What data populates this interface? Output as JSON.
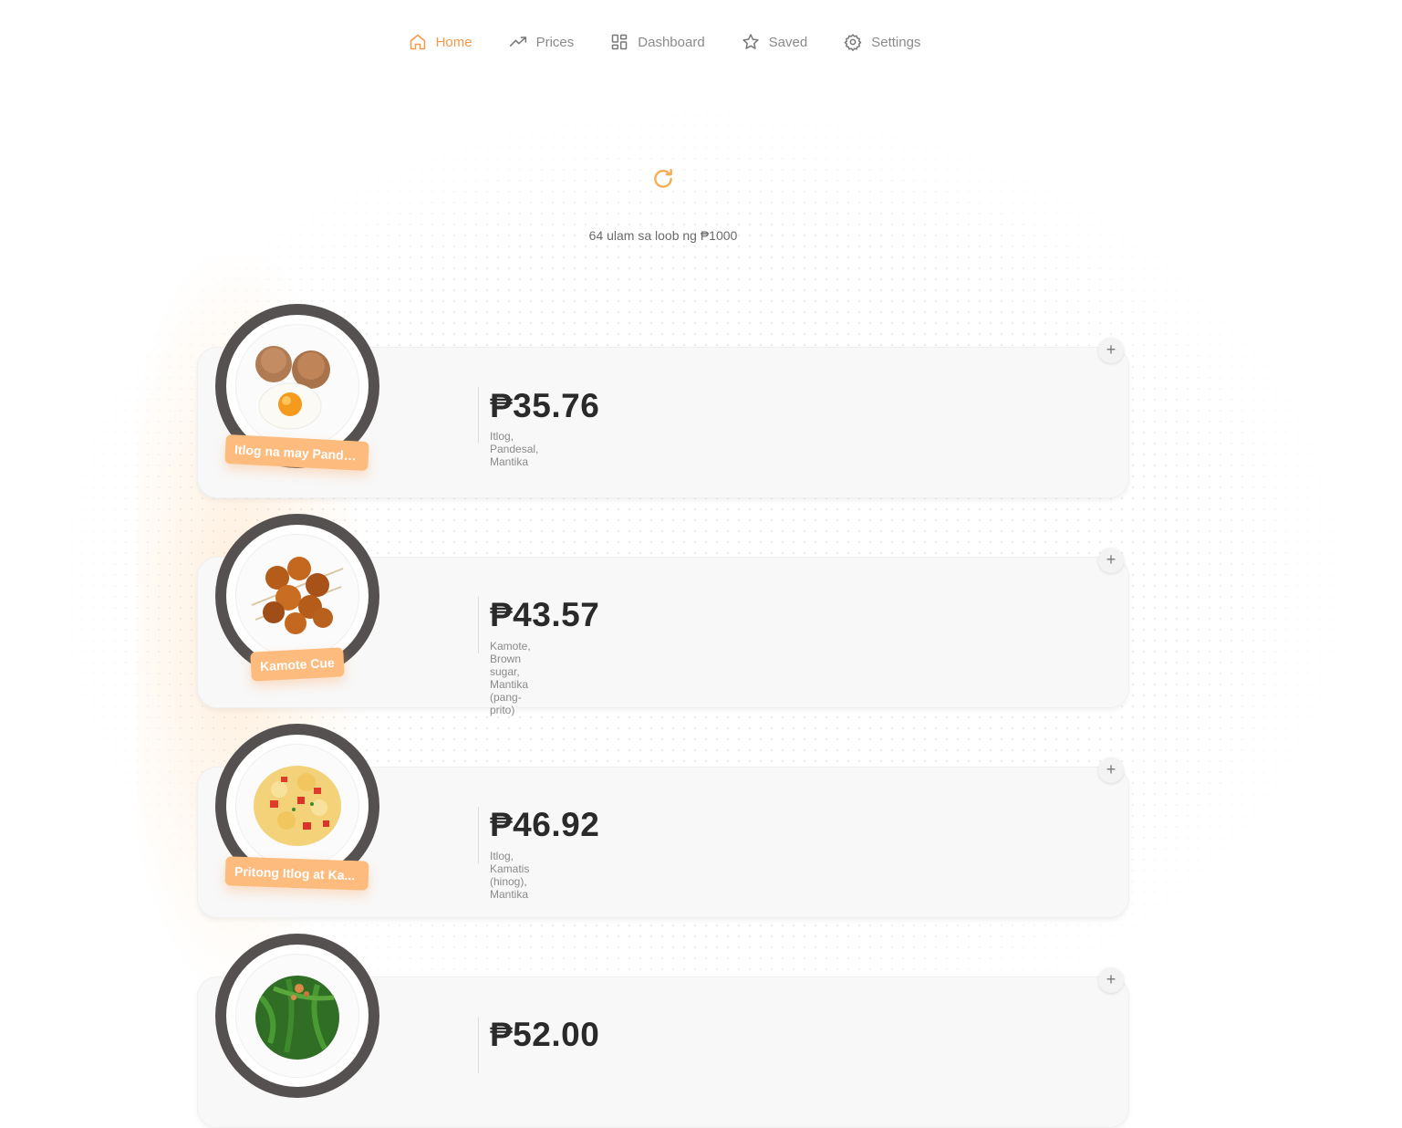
{
  "nav": {
    "items": [
      {
        "label": "Home",
        "icon": "home-icon",
        "active": true
      },
      {
        "label": "Prices",
        "icon": "trending-up-icon",
        "active": false
      },
      {
        "label": "Dashboard",
        "icon": "dashboard-grid-icon",
        "active": false
      },
      {
        "label": "Saved",
        "icon": "star-icon",
        "active": false
      },
      {
        "label": "Settings",
        "icon": "gear-icon",
        "active": false
      }
    ]
  },
  "header": {
    "refresh_icon": "refresh-icon",
    "subtitle": "64 ulam sa loob ng ₱1000"
  },
  "dishes": [
    {
      "name": "Itlog na may Pande...",
      "price": "₱35.76",
      "ingredients": "Itlog, Pandesal, Mantika",
      "add_label": "+"
    },
    {
      "name": "Kamote Cue",
      "price": "₱43.57",
      "ingredients": "Kamote, Brown sugar, Mantika (pang-prito)",
      "add_label": "+"
    },
    {
      "name": "Pritong Itlog at Ka...",
      "price": "₱46.92",
      "ingredients": "Itlog, Kamatis (hinog), Mantika",
      "add_label": "+"
    },
    {
      "name": "",
      "price": "₱52.00",
      "ingredients": "",
      "add_label": "+"
    }
  ],
  "colors": {
    "accent": "#f49a4a",
    "tag": "#fdbb7e",
    "plate": "#545150",
    "card": "#f8f8f8"
  }
}
